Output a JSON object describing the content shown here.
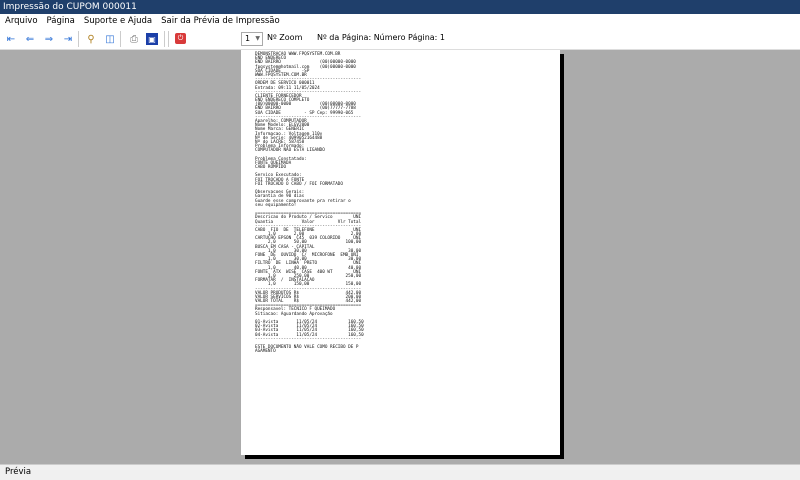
{
  "window": {
    "title": "Impressão do CUPOM 000011"
  },
  "menu": [
    "Arquivo",
    "Página",
    "Suporte e Ajuda",
    "Sair da Prévia de Impressão"
  ],
  "toolbar": {
    "zoom_value": "1",
    "zoom_label": "Nº Zoom",
    "page_label": "Nº da Página: Número Página: 1"
  },
  "document": {
    "lines": [
      "DEMONSTRACAO WWW.FPQSYSTEM.COM.BR",
      "END ENDERECO",
      "END BAIRRO               (00)00000-0000",
      "fpqsystem@hotmail.com    (00)00000-0000",
      "SUA CIDADE        -SP",
      "WWW.FPQSYSTEM.COM.BR",
      "-----------------------------------------",
      "ORDEM DE SERVICO 000011",
      "Entrada: 09:11 11/05/2024",
      "-----------------------------------------",
      "CLIENTE FORNECEDOR",
      "END ENDERECO COMPLETO",
      "(00)00000-0000           (00)00000-0000",
      "END BAIRRO               (00)77777-7788",
      "SUA CIDADE         - SP Cep: 99990-065",
      "-----------------------------------------",
      "Aparelho: COMPUTADOR",
      "Nome Modelo: ELGV2000",
      "Nome Marca: GENERIC",
      "Informacao.: Voltagem 110v",
      "Nº de Serie: 4099052164488",
      "Nº do LACRE: 587458",
      "Problema Informado:",
      "COMPUTADOR NÃO ESTA LIGANDO",
      "",
      "Problema Constatado:",
      "FONTE QUEIMADA",
      "CABO ROMPIDO",
      "",
      "Servico Executado:",
      "FOI TROCADO A FONTE",
      "FOI TROCADO O CABO / FOI FORMATADO",
      "",
      "Observacoes Gerais:",
      "Garantia de 90 dias",
      "Guarde esse comprovante pra retirar o",
      "seu equipamento!",
      "",
      "=========================================",
      "Descricao do Produto / Servico        UNI",
      "Quantia           Valor         Vlr Total",
      "-----------------------------------------",
      "CABO  FIO  DE  TELEFONE               UNI",
      "     1,0       2,00                  2,00",
      "CARTUCHO EPSON  C45  039 COLORIDO     UNI",
      "     2,0       50,00               100,00",
      "BUSCA EM CASA - CAPITAL",
      "     1,0       30,00                30,00",
      "FONE  DE  OUVIDO  C/  MICROFONE  EMB UNI",
      "     1,0       30,00                30,00",
      "FILTRO  DE  LINHA  PRETO              UNI",
      "     1,0       40,00                40,00",
      "FONTE  ATX  WISE  CASE  400 WT        UNI",
      "     1,0       250,00              250,00",
      "FORMATAR  /  INSTALACAO",
      "     1,0       150,00              150,00",
      "-----------------------------------------",
      "VALOR PRODUTOS R$                  442,00",
      "VALOR SERVICOS R$                  200,00",
      "VALOR TOTAL    R$                  442,00",
      "=========================================",
      "Responsavel: TECNICO F QUEIMADO",
      "Sitiacao: Aguardando Aprovação",
      "",
      "01-Avista       11/05/24            160,50",
      "02-Avista       11/05/24            160,50",
      "03-Avista       11/05/24            160,50",
      "04-Avista       11/05/24            160,50",
      "-----------------------------------------",
      "",
      "ESTE DOCUMENTO NÃO VALE COMO RECIBO DE P",
      "AGAMENTO"
    ]
  },
  "status": {
    "text": "Prévia"
  }
}
